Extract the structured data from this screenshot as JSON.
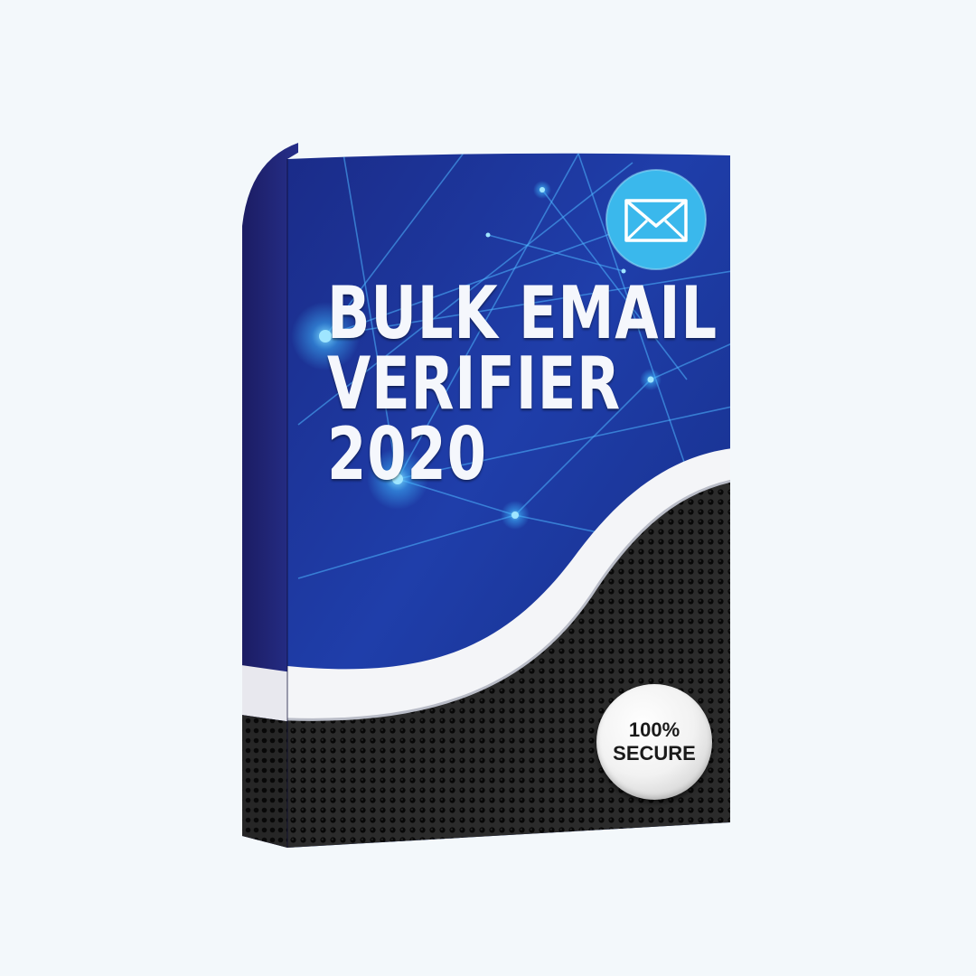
{
  "product": {
    "title_lines": [
      "BULK EMAIL",
      "VERIFIER",
      "2020"
    ],
    "seal": {
      "line1": "100%",
      "line2": "SECURE"
    },
    "icon": "envelope-icon"
  },
  "colors": {
    "background": "#f3f8fb",
    "front_blue_dark": "#12206e",
    "front_blue_light": "#2a55c8",
    "spine_blue": "#1d1f6a",
    "glow_cyan": "#4ad0ff",
    "mesh_dark": "#1e1e1e",
    "swoosh_white": "#ffffff",
    "icon_circle": "#3ab8ec"
  }
}
